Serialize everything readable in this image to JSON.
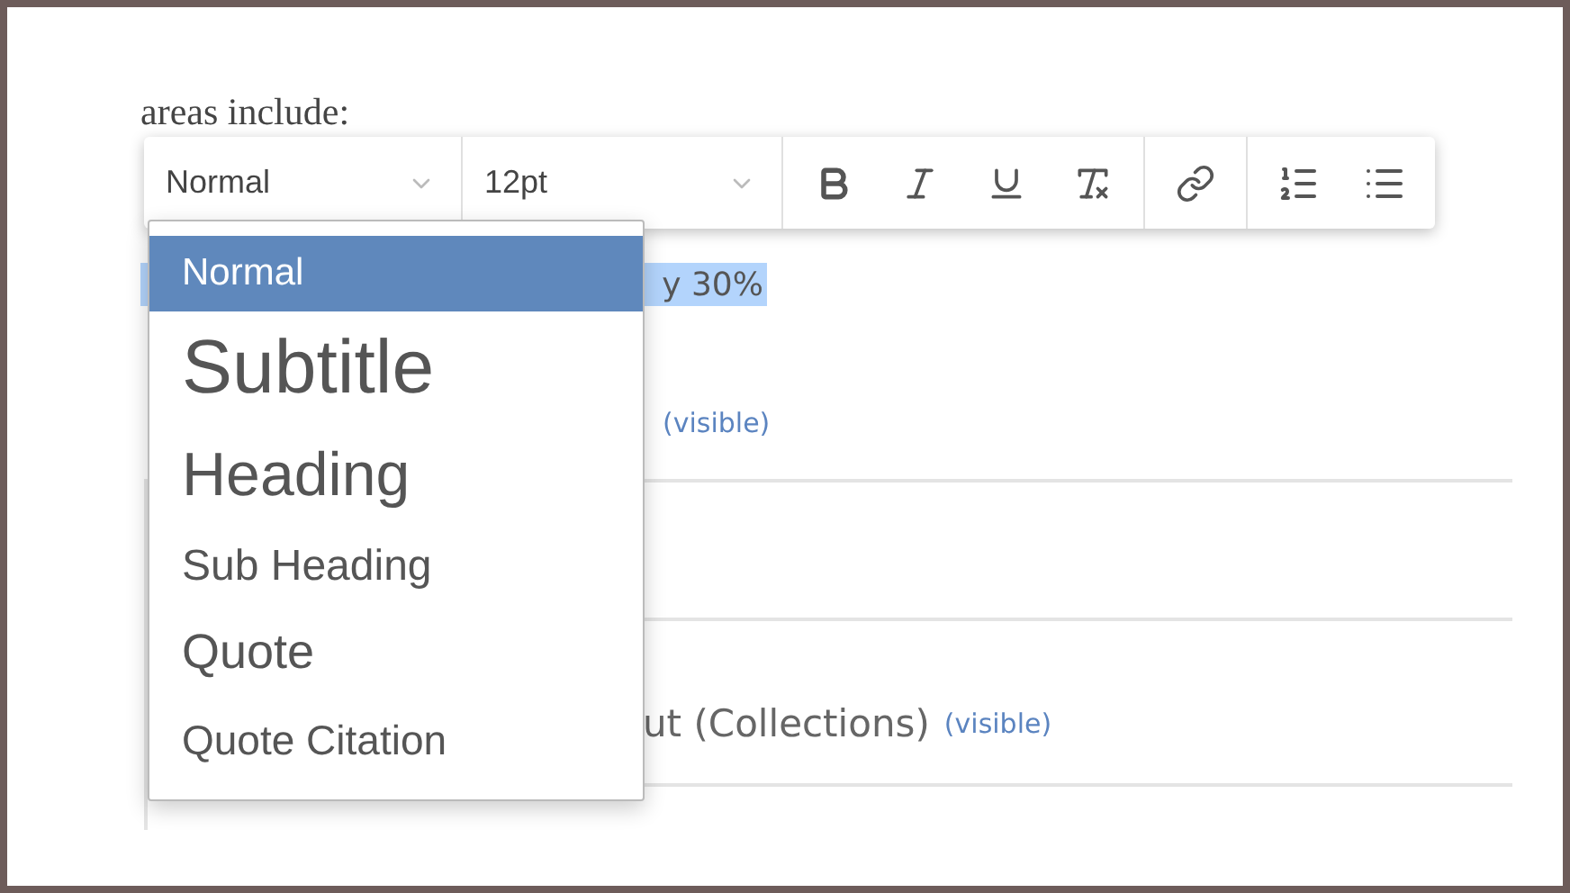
{
  "document": {
    "intro": "areas include:",
    "highlight_line": {
      "text": "y 30%"
    },
    "section_line": {
      "tag": "(visible)"
    },
    "collections_line": {
      "text": "ut (Collections)",
      "tag": "(visible)"
    }
  },
  "toolbar": {
    "style_select": {
      "value": "Normal"
    },
    "size_select": {
      "value": "12pt"
    }
  },
  "style_menu": [
    {
      "label": "Normal",
      "kind": "normal",
      "selected": true
    },
    {
      "label": "Subtitle",
      "kind": "subtitle",
      "selected": false
    },
    {
      "label": "Heading",
      "kind": "heading",
      "selected": false
    },
    {
      "label": "Sub Heading",
      "kind": "subheading",
      "selected": false
    },
    {
      "label": "Quote",
      "kind": "quote",
      "selected": false
    },
    {
      "label": "Quote Citation",
      "kind": "citation",
      "selected": false
    }
  ]
}
